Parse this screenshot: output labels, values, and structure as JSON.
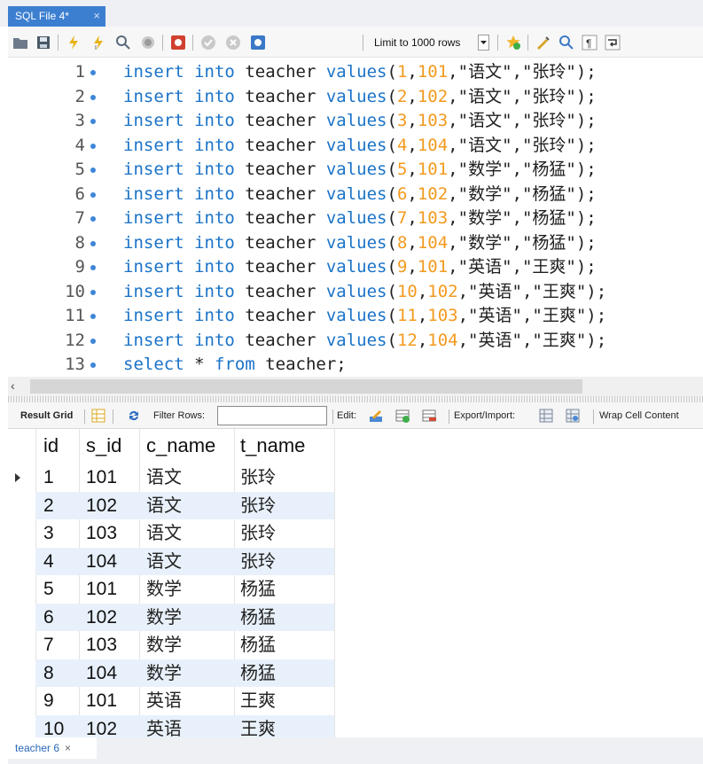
{
  "file_tab": {
    "label": "SQL File 4*",
    "close": "×"
  },
  "toolbar": {
    "limit_label": "Limit to 1000 rows",
    "icons": [
      "open-folder-icon",
      "save-icon",
      "execute-icon",
      "execute-current-icon",
      "explain-icon",
      "stop-icon",
      "toggle-continue-icon",
      "commit-icon",
      "rollback-icon",
      "autocommit-icon",
      "limit-dropdown-icon",
      "add-snippet-icon",
      "beautify-icon",
      "find-icon",
      "invisible-chars-icon",
      "wrap-icon"
    ]
  },
  "editor": {
    "lines": [
      {
        "n": "1",
        "id": "1",
        "sid": "101",
        "c": "语文",
        "t": "张玲"
      },
      {
        "n": "2",
        "id": "2",
        "sid": "102",
        "c": "语文",
        "t": "张玲"
      },
      {
        "n": "3",
        "id": "3",
        "sid": "103",
        "c": "语文",
        "t": "张玲"
      },
      {
        "n": "4",
        "id": "4",
        "sid": "104",
        "c": "语文",
        "t": "张玲"
      },
      {
        "n": "5",
        "id": "5",
        "sid": "101",
        "c": "数学",
        "t": "杨猛"
      },
      {
        "n": "6",
        "id": "6",
        "sid": "102",
        "c": "数学",
        "t": "杨猛"
      },
      {
        "n": "7",
        "id": "7",
        "sid": "103",
        "c": "数学",
        "t": "杨猛"
      },
      {
        "n": "8",
        "id": "8",
        "sid": "104",
        "c": "数学",
        "t": "杨猛"
      },
      {
        "n": "9",
        "id": "9",
        "sid": "101",
        "c": "英语",
        "t": "王爽"
      },
      {
        "n": "10",
        "id": "10",
        "sid": "102",
        "c": "英语",
        "t": "王爽"
      },
      {
        "n": "11",
        "id": "11",
        "sid": "103",
        "c": "英语",
        "t": "王爽"
      },
      {
        "n": "12",
        "id": "12",
        "sid": "104",
        "c": "英语",
        "t": "王爽"
      }
    ],
    "insert_kw": "insert",
    "into_kw": "into",
    "table_name": "teacher",
    "values_kw": "values",
    "last_line": {
      "n": "13",
      "select": "select",
      "star": "*",
      "from": "from",
      "tail": "teacher;"
    }
  },
  "result_toolbar": {
    "result_grid": "Result Grid",
    "filter_rows": "Filter Rows:",
    "filter_value": "",
    "edit": "Edit:",
    "export_import": "Export/Import:",
    "wrap": "Wrap Cell Content"
  },
  "grid": {
    "columns": [
      "id",
      "s_id",
      "c_name",
      "t_name"
    ],
    "rows": [
      [
        "1",
        "101",
        "语文",
        "张玲"
      ],
      [
        "2",
        "102",
        "语文",
        "张玲"
      ],
      [
        "3",
        "103",
        "语文",
        "张玲"
      ],
      [
        "4",
        "104",
        "语文",
        "张玲"
      ],
      [
        "5",
        "101",
        "数学",
        "杨猛"
      ],
      [
        "6",
        "102",
        "数学",
        "杨猛"
      ],
      [
        "7",
        "103",
        "数学",
        "杨猛"
      ],
      [
        "8",
        "104",
        "数学",
        "杨猛"
      ],
      [
        "9",
        "101",
        "英语",
        "王爽"
      ],
      [
        "10",
        "102",
        "英语",
        "王爽"
      ]
    ]
  },
  "bottom_tab": {
    "label": "teacher 6",
    "close": "×"
  }
}
